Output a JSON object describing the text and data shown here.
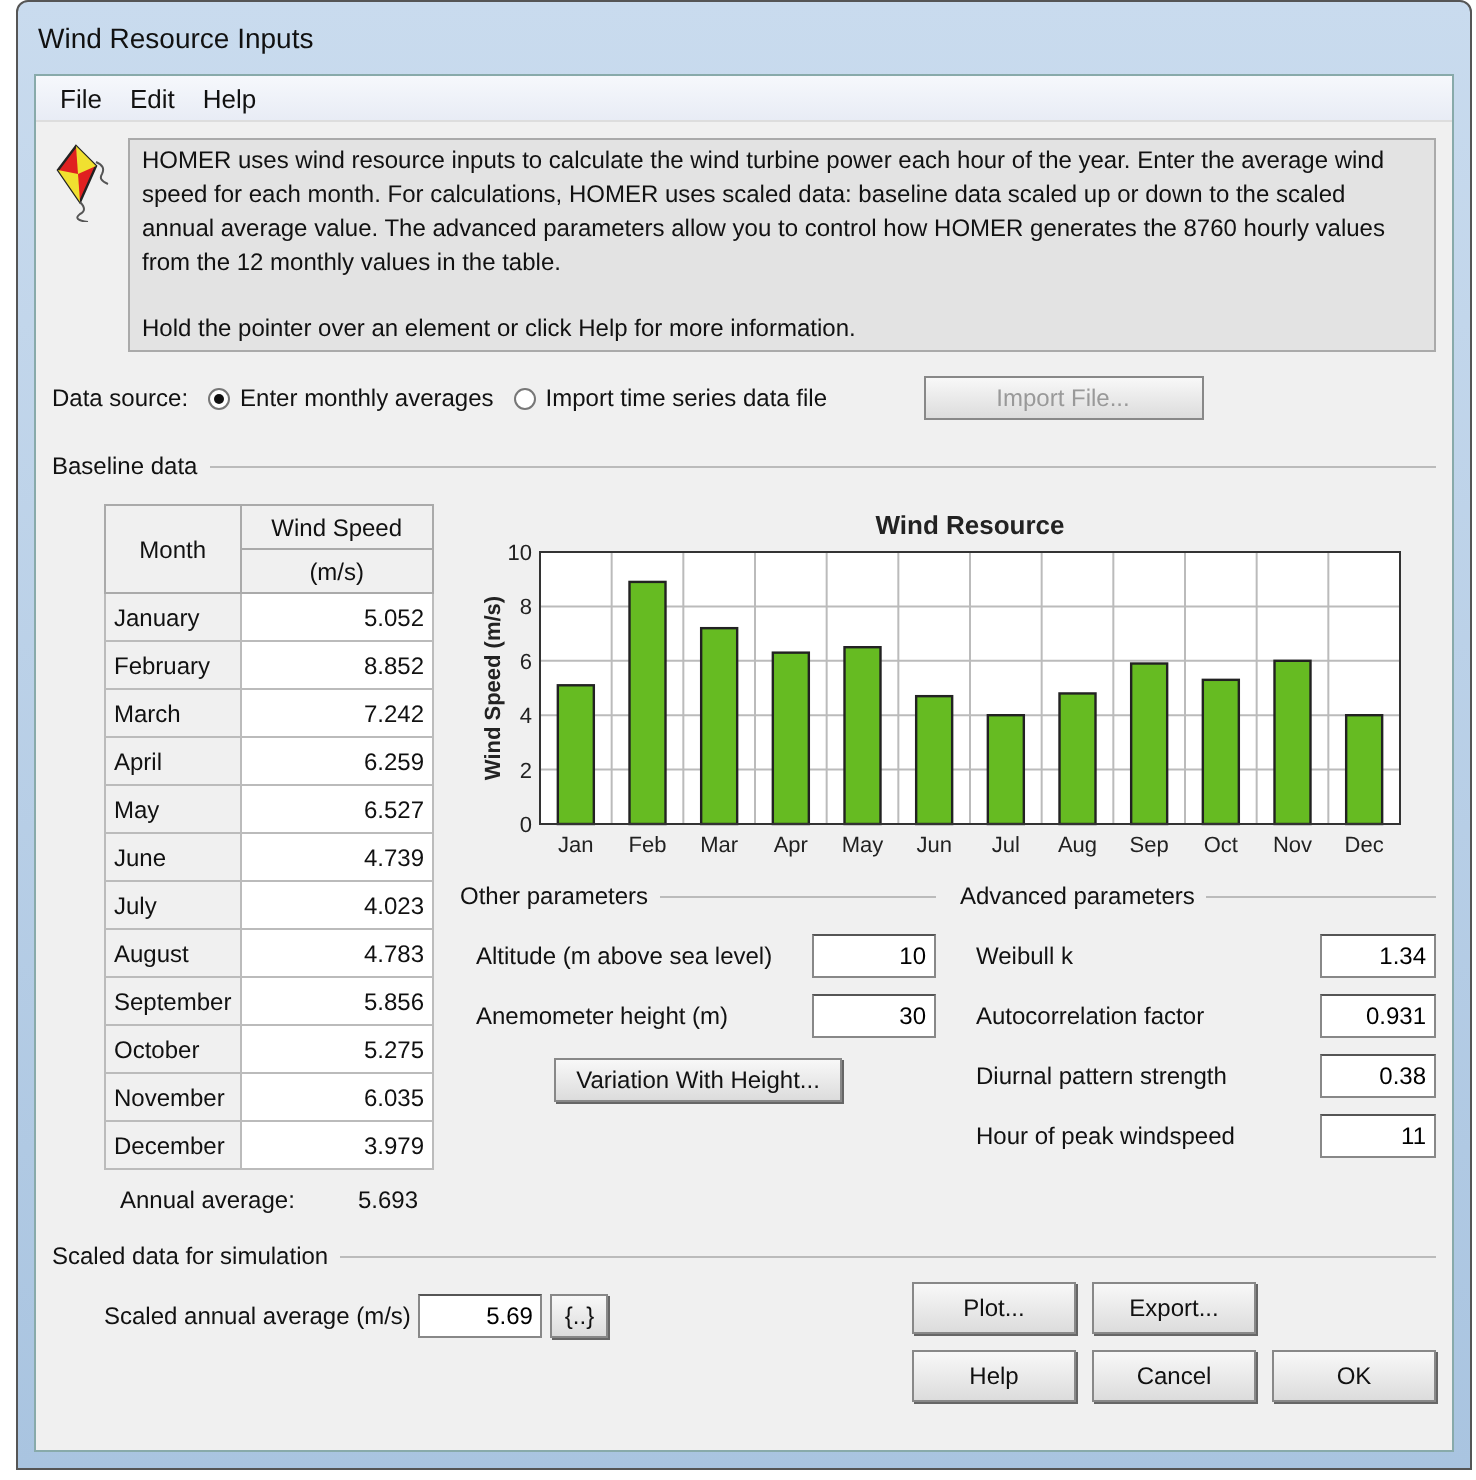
{
  "window": {
    "title": "Wind Resource Inputs"
  },
  "menu": [
    "File",
    "Edit",
    "Help"
  ],
  "info": {
    "paragraphs": [
      "HOMER uses wind resource inputs to calculate the wind turbine power each hour of the year. Enter the average wind speed for each month. For calculations, HOMER uses scaled data: baseline data scaled up or down to the scaled annual average value. The advanced parameters allow you to control how HOMER generates the 8760 hourly values from the 12 monthly values in the table.",
      "Hold the pointer over an element or click Help for more information."
    ]
  },
  "data_source": {
    "label": "Data source:",
    "options": [
      {
        "label": "Enter monthly averages",
        "selected": true
      },
      {
        "label": "Import time series data file",
        "selected": false
      }
    ],
    "import_button": {
      "label": "Import File...",
      "disabled": true
    }
  },
  "baseline": {
    "title": "Baseline data",
    "table": {
      "columns": [
        {
          "label": "Month"
        },
        {
          "label": "Wind Speed",
          "unit": "(m/s)"
        }
      ],
      "rows": [
        {
          "month": "January",
          "speed": "5.052"
        },
        {
          "month": "February",
          "speed": "8.852"
        },
        {
          "month": "March",
          "speed": "7.242"
        },
        {
          "month": "April",
          "speed": "6.259"
        },
        {
          "month": "May",
          "speed": "6.527"
        },
        {
          "month": "June",
          "speed": "4.739"
        },
        {
          "month": "July",
          "speed": "4.023"
        },
        {
          "month": "August",
          "speed": "4.783"
        },
        {
          "month": "September",
          "speed": "5.856"
        },
        {
          "month": "October",
          "speed": "5.275"
        },
        {
          "month": "November",
          "speed": "6.035"
        },
        {
          "month": "December",
          "speed": "3.979"
        }
      ]
    },
    "annual_average": {
      "label": "Annual average:",
      "value": "5.693"
    },
    "chart_data": {
      "type": "bar",
      "title": "Wind Resource",
      "ylabel": "Wind Speed (m/s)",
      "categories": [
        "Jan",
        "Feb",
        "Mar",
        "Apr",
        "May",
        "Jun",
        "Jul",
        "Aug",
        "Sep",
        "Oct",
        "Nov",
        "Dec"
      ],
      "values": [
        5.1,
        8.9,
        7.2,
        6.3,
        6.5,
        4.7,
        4.0,
        4.8,
        5.9,
        5.3,
        6.0,
        4.0
      ],
      "ylim": [
        0,
        10
      ],
      "yticks": [
        0,
        2,
        4,
        6,
        8,
        10
      ],
      "grid": true
    }
  },
  "other_parameters": {
    "title": "Other parameters",
    "fields": [
      {
        "label": "Altitude (m above sea level)",
        "value": "10"
      },
      {
        "label": "Anemometer height (m)",
        "value": "30"
      }
    ],
    "button": "Variation With Height..."
  },
  "advanced_parameters": {
    "title": "Advanced parameters",
    "fields": [
      {
        "label": "Weibull k",
        "value": "1.34"
      },
      {
        "label": "Autocorrelation factor",
        "value": "0.931"
      },
      {
        "label": "Diurnal pattern strength",
        "value": "0.38"
      },
      {
        "label": "Hour of peak windspeed",
        "value": "11"
      }
    ]
  },
  "scaled": {
    "title": "Scaled data for simulation",
    "field": {
      "label": "Scaled annual average (m/s)",
      "value": "5.69"
    },
    "button": "{..}"
  },
  "buttons": [
    [
      "Plot...",
      "Export..."
    ],
    [
      "Help",
      "Cancel",
      "OK"
    ]
  ]
}
